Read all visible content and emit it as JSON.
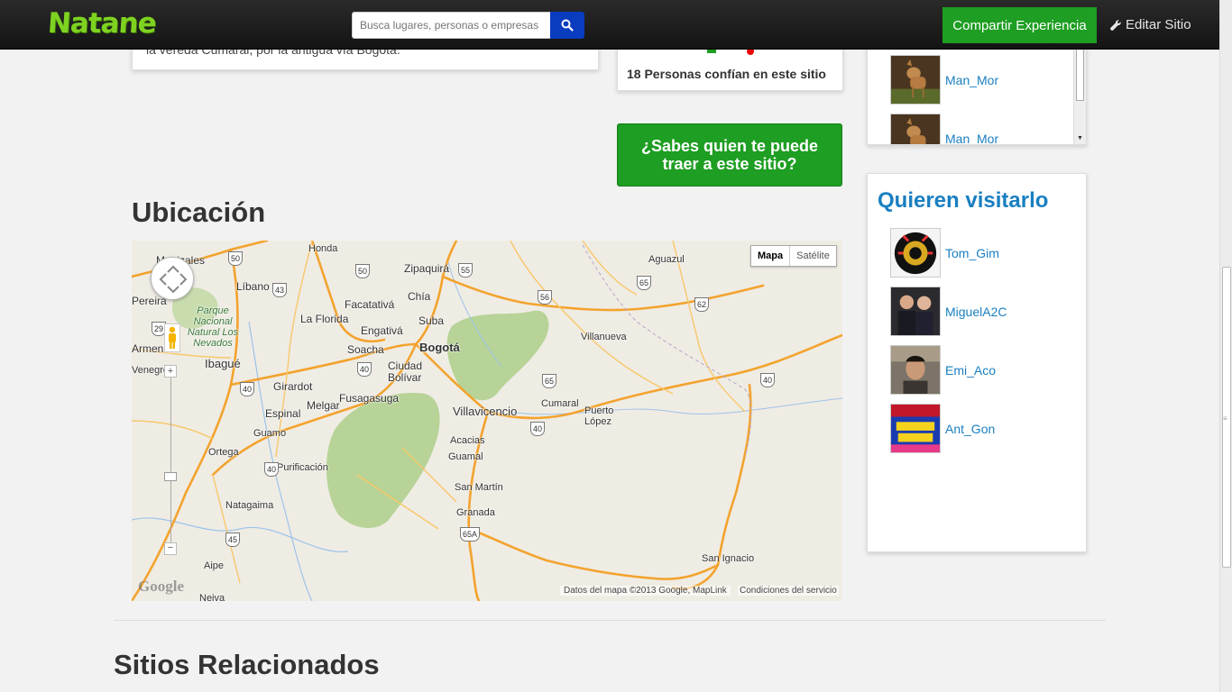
{
  "navbar": {
    "logo": "Natane",
    "search_placeholder": "Busca lugares, personas o empresas",
    "share_label": "Compartir Experiencia",
    "edit_label": "Editar Sitio"
  },
  "description": {
    "text": "la vereda Cumaral, por la antigua vía Bogotá."
  },
  "trust": {
    "text": "18 Personas confían en este sitio"
  },
  "cta": {
    "label": "¿Sabes quien te puede traer a este sitio?"
  },
  "location": {
    "heading": "Ubicación",
    "map_type_map": "Mapa",
    "map_type_satellite": "Satélite",
    "attribution": "Datos del mapa ©2013 Google, MapLink",
    "terms": "Condiciones del servicio",
    "google_logo": "Google",
    "zoom_in": "+",
    "zoom_out": "−",
    "places": [
      "Manizales",
      "Honda",
      "Zipaquirá",
      "Aguazul",
      "Líbano",
      "Pereira",
      "Parque Nacional Natural Los Nevados",
      "Facatativá",
      "Chía",
      "La Florida",
      "Suba",
      "Engativá",
      "Bogotá",
      "Villanueva",
      "Soacha",
      "Armenia",
      "Ibagué",
      "Ciudad Bolívar",
      "Girardot",
      "Fusagasuga",
      "Melgar",
      "Espinal",
      "Villavicencio",
      "Cumaral",
      "Puerto López",
      "Guamo",
      "Ortega",
      "Acacias",
      "Guamal",
      "Purificación",
      "Natagaima",
      "San Martín",
      "Granada",
      "Aipe",
      "San Ignacio",
      "Neiva",
      "Venegro"
    ],
    "route_numbers": [
      "50",
      "55",
      "65",
      "50",
      "43",
      "29",
      "56",
      "62",
      "40",
      "40",
      "65",
      "40",
      "40",
      "45",
      "65A",
      "40"
    ]
  },
  "trust_list": {
    "users": [
      {
        "name": "Man_Mor"
      },
      {
        "name": "Man_Mor"
      }
    ]
  },
  "visitors": {
    "title": "Quieren visitarlo",
    "users": [
      {
        "name": "Tom_Gim"
      },
      {
        "name": "MiguelA2C"
      },
      {
        "name": "Emi_Aco"
      },
      {
        "name": "Ant_Gon"
      }
    ]
  },
  "related": {
    "heading": "Sitios Relacionados"
  },
  "colors": {
    "brand_green": "#1e9e22",
    "logo_green": "#7ed321",
    "link_blue": "#1a7fc1",
    "search_blue": "#0a3cc0",
    "road_orange": "#f3a32e"
  }
}
